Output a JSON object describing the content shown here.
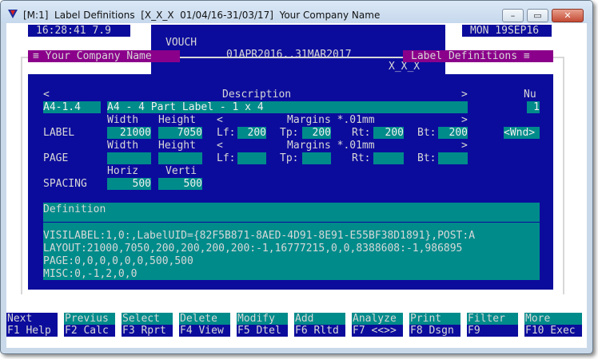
{
  "window": {
    "title": "[M:1]  Label Definitions  [X_X_X  01/04/16-31/03/17]  Your Company Name",
    "minimize_glyph": "–",
    "maximize_glyph": "▭",
    "close_glyph": "✕"
  },
  "status_bar": {
    "time": "16:28:41 7.9",
    "module": "VOUCH",
    "period": "01APR2016..31MAR2017",
    "company_code": "X_X_X",
    "date": "MON 19SEP16"
  },
  "panel": {
    "company_tab": "≡ Your Company Name",
    "screen_tab": "Label Definitions ≡"
  },
  "header": {
    "left_arrow": "<",
    "description_label": "Description",
    "right_arrow": ">",
    "num_label": "Nu"
  },
  "record": {
    "code": "A4-1.4",
    "description": "A4 - 4 Part Label - 1 x 4",
    "number": "1"
  },
  "label_section": {
    "row_label": "LABEL",
    "width_label": "Width",
    "height_label": "Height",
    "width": "21000",
    "height": "7050",
    "margins_left_arrow": "<",
    "margins_label": "Margins *.01mm",
    "margins_right_arrow": ">",
    "lf_label": "Lf:",
    "lf": "200",
    "tp_label": "Tp:",
    "tp": "200",
    "rt_label": "Rt:",
    "rt": "200",
    "bt_label": "Bt:",
    "bt": "200",
    "wnd_button": "<Wnd>"
  },
  "page_section": {
    "row_label": "PAGE",
    "width_label": "Width",
    "height_label": "Height",
    "width": "",
    "height": "",
    "margins_left_arrow": "<",
    "margins_label": "Margins *.01mm",
    "margins_right_arrow": ">",
    "lf_label": "Lf:",
    "lf": "",
    "tp_label": "Tp:",
    "tp": "",
    "rt_label": "Rt:",
    "rt": "",
    "bt_label": "Bt:",
    "bt": ""
  },
  "spacing_section": {
    "row_label": "SPACING",
    "horiz_label": "Horiz",
    "verti_label": "Verti",
    "horiz": "500",
    "verti": "500"
  },
  "definition": {
    "heading": "Definition",
    "lines": [
      "VISILABEL:1,0:,LabelUID={82F5B871-8AED-4D91-8E91-E55BF38D1891},POST:A",
      "LAYOUT:21000,7050,200,200,200,200:-1,16777215,0,0,8388608:-1,986895",
      "PAGE:0,0,0,0,0,0,500,500",
      "MISC:0,-1,2,0,0"
    ]
  },
  "function_keys": [
    {
      "action": "Next",
      "key": "F1 Help"
    },
    {
      "action": "Previus",
      "key": "F2 Calc"
    },
    {
      "action": "Select",
      "key": "F3 Rprt"
    },
    {
      "action": "Delete",
      "key": "F4 View"
    },
    {
      "action": "Modify",
      "key": "F5 Dtel"
    },
    {
      "action": "Add",
      "key": "F6 Rltd"
    },
    {
      "action": "Analyze",
      "key": "F7 <<>>"
    },
    {
      "action": "Print",
      "key": "F8 Dsgn"
    },
    {
      "action": "Filter",
      "key": "F9"
    },
    {
      "action": "More",
      "key": "F10 Exec"
    }
  ],
  "colors": {
    "screen_blue": "#0c0c9c",
    "field_cyan": "#008b8b",
    "tab_magenta": "#8b008b",
    "text_grey": "#d8d8d8"
  }
}
